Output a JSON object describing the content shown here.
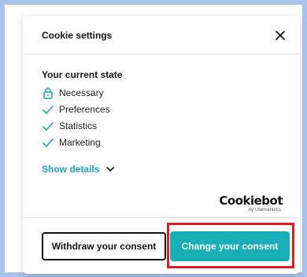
{
  "dialog": {
    "title": "Cookie settings",
    "close_icon": "close-icon",
    "state_title": "Your current state",
    "items": [
      {
        "label": "Necessary",
        "icon": "lock-icon"
      },
      {
        "label": "Preferences",
        "icon": "check-icon"
      },
      {
        "label": "Statistics",
        "icon": "check-icon"
      },
      {
        "label": "Marketing",
        "icon": "check-icon"
      }
    ],
    "show_details": "Show details",
    "logo": {
      "name": "Cookiebot",
      "tagline": "by Usercentrics"
    },
    "buttons": {
      "withdraw": "Withdraw your consent",
      "change": "Change your consent"
    }
  },
  "colors": {
    "accent": "#18aeb5",
    "highlight": "#e01c24",
    "frame": "#a9c4ea"
  }
}
